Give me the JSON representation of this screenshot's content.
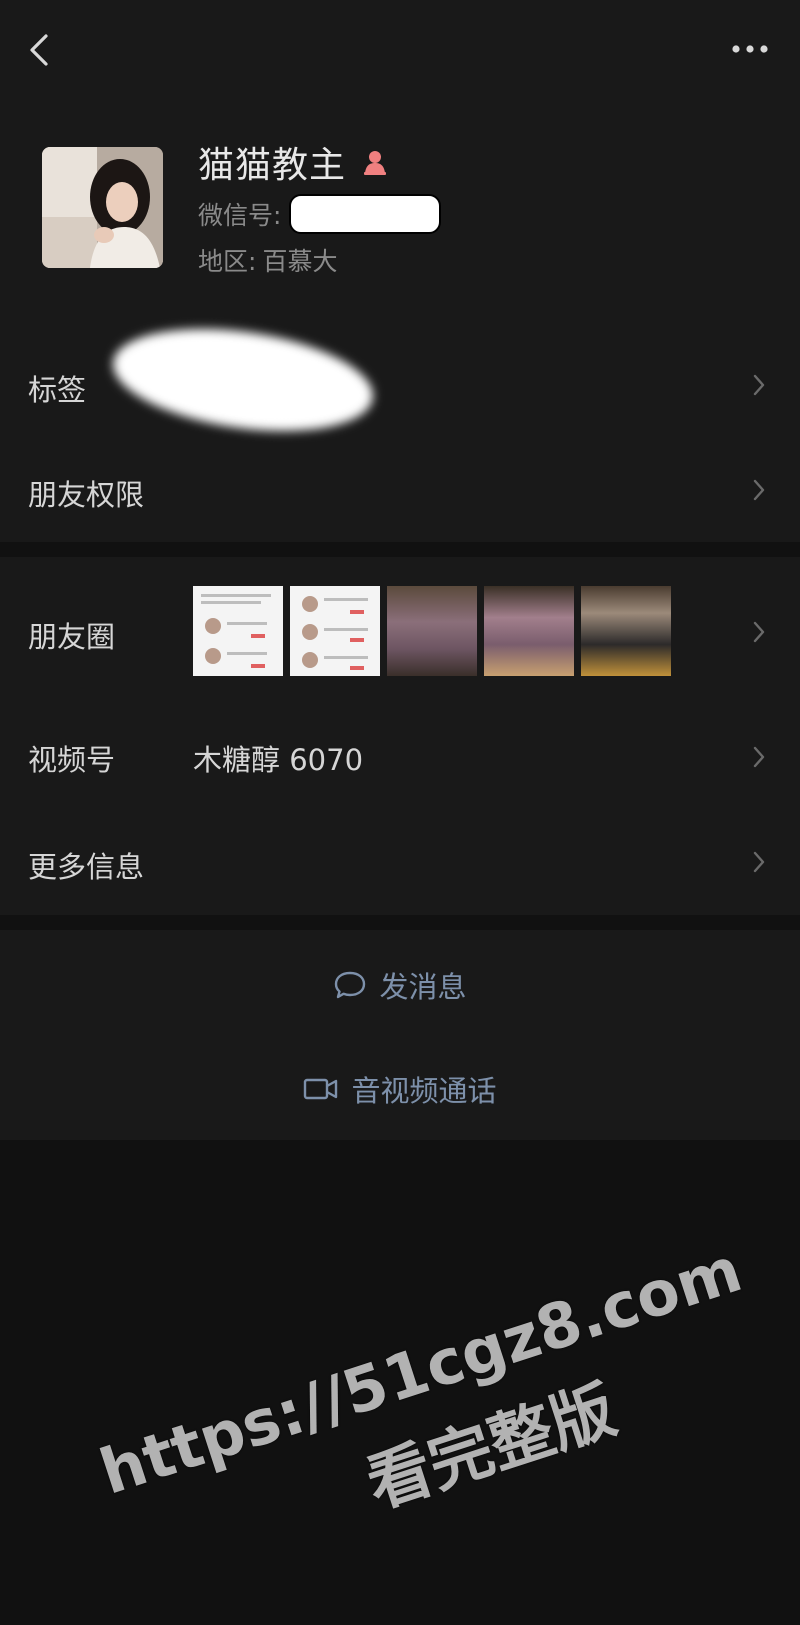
{
  "profile": {
    "nickname": "猫猫教主",
    "wxid_label": "微信号:",
    "region_label": "地区:",
    "region_value": "百慕大"
  },
  "rows": {
    "tags_label": "标签",
    "permissions_label": "朋友权限",
    "moments_label": "朋友圈",
    "channels_label": "视频号",
    "channels_value": "木糖醇 6070",
    "more_info_label": "更多信息"
  },
  "actions": {
    "message_label": "发消息",
    "call_label": "音视频通话"
  },
  "watermark": {
    "url": "https://51cgz8.com",
    "subtitle": "看完整版"
  },
  "icons": {
    "back": "chevron-left-icon",
    "more": "more-dots-icon",
    "gender": "female-icon",
    "chevron": "chevron-right-icon",
    "message": "chat-bubble-icon",
    "call": "video-camera-icon"
  },
  "colors": {
    "background": "#111111",
    "panel": "#191919",
    "link_blue": "#7d90aa",
    "gender_female": "#f08080"
  }
}
